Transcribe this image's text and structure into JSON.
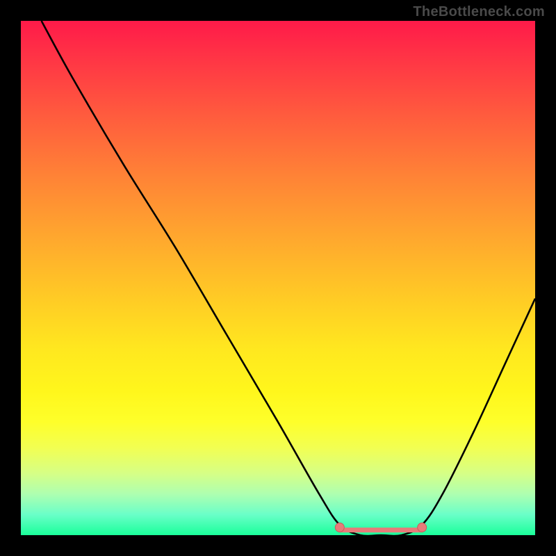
{
  "watermark_text": "TheBottleneck.com",
  "colors": {
    "page_bg": "#000000",
    "watermark": "#4a4a4a",
    "curve": "#000000",
    "marker_fill": "#e77b79",
    "marker_stroke": "#c95b59",
    "bottom_band": "#1aff9a"
  },
  "chart_data": {
    "type": "line",
    "title": "",
    "xlabel": "",
    "ylabel": "",
    "xlim": [
      0,
      100
    ],
    "ylim": [
      0,
      100
    ],
    "notes": "V-shaped bottleneck curve over red-to-green vertical gradient. No axes, ticks, or numeric labels are visible; x and y values are normalized 0–100 estimates from pixel positions. Green bottom band indicates the optimal (no-bottleneck) region; two salmon markers and a short salmon segment highlight the flat optimum interval.",
    "series": [
      {
        "name": "bottleneck-curve",
        "x": [
          4,
          10,
          20,
          30,
          40,
          50,
          58,
          62,
          66,
          70,
          74,
          78,
          82,
          88,
          94,
          100
        ],
        "y": [
          100,
          89,
          72,
          56,
          39,
          22,
          8,
          2,
          0,
          0,
          0,
          2,
          8,
          20,
          33,
          46
        ]
      }
    ],
    "markers": [
      {
        "name": "optimum-start",
        "x": 62,
        "y": 1.5
      },
      {
        "name": "optimum-end",
        "x": 78,
        "y": 1.5
      }
    ],
    "optimum_segment": {
      "x0": 62,
      "x1": 78,
      "y": 1
    },
    "gradient_stops": [
      {
        "pos": 0,
        "color": "#ff1a49"
      },
      {
        "pos": 18,
        "color": "#ff5a3e"
      },
      {
        "pos": 42,
        "color": "#ffa72e"
      },
      {
        "pos": 64,
        "color": "#ffe81f"
      },
      {
        "pos": 83,
        "color": "#f2ff52"
      },
      {
        "pos": 100,
        "color": "#1aff9a"
      }
    ]
  }
}
